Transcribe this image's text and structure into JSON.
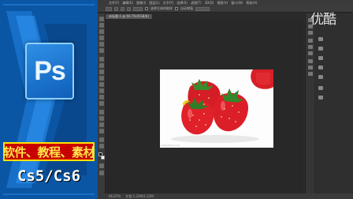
{
  "promo": {
    "logo_text": "Ps",
    "caption": "软件、教程、素材",
    "version": "Cs5/Cs6"
  },
  "watermark": "优酷",
  "menubar": {
    "items": [
      "文件(F)",
      "编辑(E)",
      "图像(I)",
      "图层(L)",
      "文字(Y)",
      "选择(S)",
      "滤镜(T)",
      "3D(D)",
      "视图(V)",
      "窗口(W)",
      "帮助(H)"
    ]
  },
  "optionsbar": {
    "label1": "选择主体的取样",
    "label2": "自动增强"
  },
  "document": {
    "tab_label": "未标题-1 @ 66.7%(RGB/8)"
  },
  "canvas": {
    "photo_caption": "www.photo.com"
  },
  "statusbar": {
    "zoom": "66.67%",
    "doc_info": "文档:1.22M/1.22M"
  },
  "colors": {
    "promo_bg": "#0a4f98",
    "caption_bg": "#c80000",
    "caption_text": "#ffe84a",
    "workspace_bg": "#282828",
    "strawberry": "#e0202a"
  }
}
